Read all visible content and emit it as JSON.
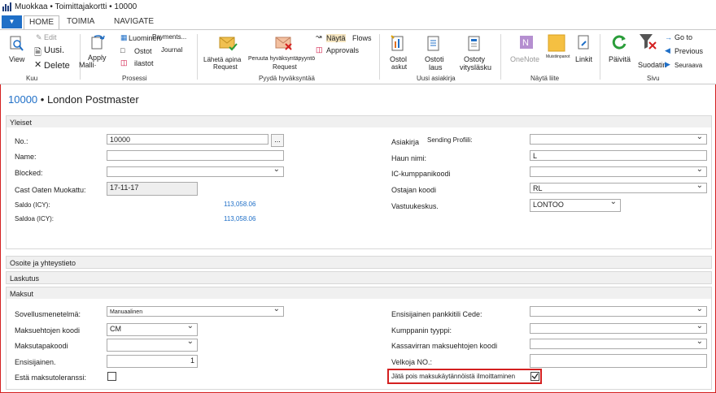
{
  "window": {
    "title": "Muokkaa • Toimittajakortti • 10000"
  },
  "tabs": {
    "home": "HOME",
    "actions": "TOIMIA",
    "navigate": "NAVIGATE"
  },
  "ribbon": {
    "view": "View",
    "edit": "Edit",
    "new": "Uusi.",
    "delete": "Delete",
    "apply_template": "Apply",
    "template": "Malli·",
    "create": "Luominen",
    "payments": "Payments...",
    "journal": "Journal",
    "orders": "Ostot",
    "reports": "ilastot",
    "send_approval": "Lähetä apina",
    "request": "Request",
    "cancel_approval": "Peruuta hyväksyntäpyyntö",
    "cancel_request": "Request",
    "show": "Näytä",
    "flows": "Flows",
    "approvals": "Approvals",
    "purchase_quote_1": "Ostol",
    "purchase_quote_2": "askut",
    "purchase_order_1": "Ostoti",
    "purchase_order_2": "laus",
    "purchase_invoice_1": "Ostoty",
    "purchase_invoice_2": "vitysläsku",
    "onenote": "OneNote",
    "notes": "Muistiinpanot",
    "links": "Linkit",
    "refresh": "Päivitä",
    "filter": "Suodatin",
    "goto": "Go to",
    "previous": "Previous",
    "next": "Seuraava",
    "groups": {
      "view": "Kuu",
      "process": "Prosessi",
      "approval": "Pyydä hyväksyntää",
      "new_doc": "Uusi asiakirja",
      "show_attached": "Näytä liite",
      "page": "Sivu"
    }
  },
  "header": {
    "no": "10000",
    "name": "• London Postmaster"
  },
  "sections": {
    "general": "Yleiset",
    "address": "Osoite ja yhteystieto",
    "invoicing": "Laskutus",
    "payments": "Maksut"
  },
  "general": {
    "no_label": "No.:",
    "no_value": "10000",
    "name_label": "Name:",
    "name_value": "",
    "blocked_label": "Blocked:",
    "blocked_value": "",
    "last_modified_label": "Cast Oaten Muokattu:",
    "last_modified_value": "17-11-17",
    "balance_lcy_label": "Saldo (ICY):",
    "balance_lcy_value": "113,058.06",
    "balance_due_label": "Saldoa (ICY):",
    "balance_due_value": "113,058.06",
    "document_label": "Asiakirja",
    "sending_profile_label": "Sending Profiili:",
    "sending_profile_value": "",
    "search_name_label": "Haun nimi:",
    "search_name_value": "L",
    "ic_partner_label": "IC-kumppanikoodi",
    "ic_partner_value": "",
    "purchaser_label": "Ostajan koodi",
    "purchaser_value": "RL",
    "responsibility_label": "Vastuukeskus.",
    "responsibility_value": "LONTOO"
  },
  "payments": {
    "application_method_label": "Sovellusmenetelmä:",
    "application_method_value": "Manuaalinen",
    "payment_terms_label": "Maksuehtojen koodi",
    "payment_terms_value": "CM",
    "payment_method_label": "Maksutapakoodi",
    "payment_method_value": "",
    "priority_label": "Ensisijainen.",
    "priority_value": "1",
    "block_tolerance_label": "Estä maksutoleranssi:",
    "preferred_bank_label": "Ensisijainen pankkitili Cede:",
    "preferred_bank_value": "",
    "partner_type_label": "Kumppanin tyyppi:",
    "partner_type_value": "",
    "cash_flow_label": "Kassavirran maksuehtojen koodi",
    "cash_flow_value": "",
    "creditor_no_label": "Velkoja NO.:",
    "creditor_no_value": "",
    "exclude_payment_label": "Jätä pois maksukäytännöistä ilmoittaminen"
  },
  "colors": {
    "accent": "#1f6fc7",
    "highlight": "#d42020"
  }
}
